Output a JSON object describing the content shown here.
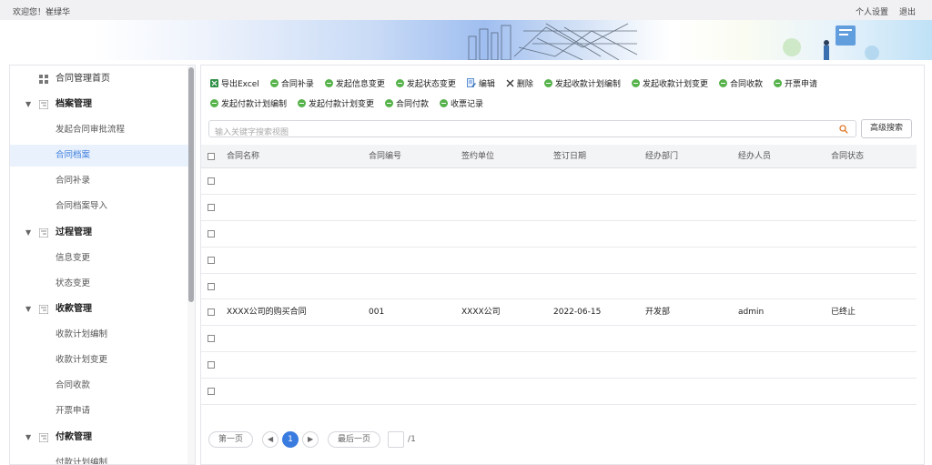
{
  "topbar": {
    "welcome": "欢迎您！崔绿华",
    "personal_settings": "个人设置",
    "logout": "退出"
  },
  "sidebar": {
    "items": [
      {
        "label": "合同管理首页",
        "kind": "top",
        "icon": "home-grid-icon"
      },
      {
        "label": "档案管理",
        "kind": "group",
        "icon": "folder-tree-icon"
      },
      {
        "label": "发起合同审批流程",
        "kind": "sub"
      },
      {
        "label": "合同档案",
        "kind": "sub",
        "active": true
      },
      {
        "label": "合同补录",
        "kind": "sub"
      },
      {
        "label": "合同档案导入",
        "kind": "sub"
      },
      {
        "label": "过程管理",
        "kind": "group",
        "icon": "folder-tree-icon"
      },
      {
        "label": "信息变更",
        "kind": "sub"
      },
      {
        "label": "状态变更",
        "kind": "sub"
      },
      {
        "label": "收款管理",
        "kind": "group",
        "icon": "folder-tree-icon"
      },
      {
        "label": "收款计划编制",
        "kind": "sub"
      },
      {
        "label": "收款计划变更",
        "kind": "sub"
      },
      {
        "label": "合同收款",
        "kind": "sub"
      },
      {
        "label": "开票申请",
        "kind": "sub"
      },
      {
        "label": "付款管理",
        "kind": "group",
        "icon": "folder-tree-icon"
      },
      {
        "label": "付款计划编制",
        "kind": "sub"
      }
    ]
  },
  "toolbar": {
    "row1": [
      {
        "label": "导出Excel",
        "icon": "excel-icon"
      },
      {
        "label": "合同补录",
        "icon": "green-circle-icon"
      },
      {
        "label": "发起信息变更",
        "icon": "green-circle-icon"
      },
      {
        "label": "发起状态变更",
        "icon": "green-circle-icon"
      },
      {
        "label": "编辑",
        "icon": "edit-document-icon"
      },
      {
        "label": "删除",
        "icon": "delete-x-icon"
      },
      {
        "label": "发起收款计划编制",
        "icon": "green-circle-icon"
      },
      {
        "label": "发起收款计划变更",
        "icon": "green-circle-icon"
      },
      {
        "label": "合同收款",
        "icon": "green-circle-icon"
      },
      {
        "label": "开票申请",
        "icon": "green-circle-icon"
      }
    ],
    "row2": [
      {
        "label": "发起付款计划编制",
        "icon": "green-circle-icon"
      },
      {
        "label": "发起付款计划变更",
        "icon": "green-circle-icon"
      },
      {
        "label": "合同付款",
        "icon": "green-circle-icon"
      },
      {
        "label": "收票记录",
        "icon": "green-circle-icon"
      }
    ]
  },
  "search": {
    "placeholder": "输入关键字搜索视图",
    "value": "",
    "advanced_label": "高级搜索"
  },
  "table": {
    "columns": [
      "合同名称",
      "合同编号",
      "签约单位",
      "签订日期",
      "经办部门",
      "经办人员",
      "合同状态"
    ],
    "rows": [
      [
        "",
        "",
        "",
        "",
        "",
        "",
        ""
      ],
      [
        "",
        "",
        "",
        "",
        "",
        "",
        ""
      ],
      [
        "",
        "",
        "",
        "",
        "",
        "",
        ""
      ],
      [
        "",
        "",
        "",
        "",
        "",
        "",
        ""
      ],
      [
        "",
        "",
        "",
        "",
        "",
        "",
        ""
      ],
      [
        "XXXX公司的购买合同",
        "001",
        "XXXX公司",
        "2022-06-15",
        "开发部",
        "admin",
        "已终止"
      ],
      [
        "",
        "",
        "",
        "",
        "",
        "",
        ""
      ],
      [
        "",
        "",
        "",
        "",
        "",
        "",
        ""
      ],
      [
        "",
        "",
        "",
        "",
        "",
        "",
        ""
      ]
    ]
  },
  "pager": {
    "first": "第一页",
    "prev": "◀",
    "current": "1",
    "next": "▶",
    "last": "最后一页",
    "total": "/1"
  },
  "colors": {
    "accent": "#3a7be0",
    "green_icon": "#56b24a",
    "active_bg": "#e9f1fc"
  }
}
